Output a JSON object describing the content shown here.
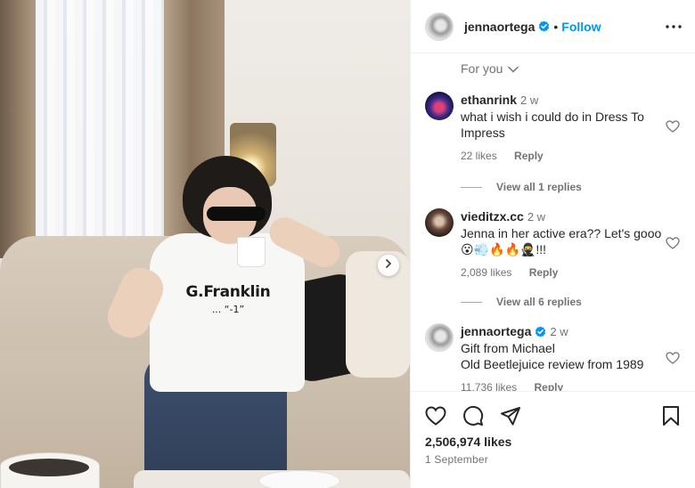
{
  "post": {
    "image_text": {
      "shirt_main": "G.Franklin",
      "shirt_sub": "... “-1”"
    }
  },
  "header": {
    "username": "jennaortega",
    "dot": "•",
    "follow_label": "Follow"
  },
  "comments_header": {
    "sort_label": "For you"
  },
  "comments": [
    {
      "username": "ethanrink",
      "time": "2 w",
      "text": "what i wish i could do in Dress To Impress",
      "likes": "22 likes",
      "reply_label": "Reply",
      "view_replies": "View all 1 replies"
    },
    {
      "username": "vieditzx.cc",
      "time": "2 w",
      "text": "Jenna in her active era?? Let's gooo",
      "emoji_line": "😮💨🔥🔥🥷!!!",
      "likes": "2,089 likes",
      "reply_label": "Reply",
      "view_replies": "View all 6 replies"
    },
    {
      "username": "jennaortega",
      "time": "2 w",
      "text": "Gift from Michael",
      "text2": "Old Beetlejuice review from 1989",
      "likes": "11,736 likes",
      "reply_label": "Reply"
    }
  ],
  "footer": {
    "likes_count": "2,506,974 likes",
    "date": "1 September"
  },
  "colors": {
    "accent": "#0095f6",
    "verified": "#0095f6",
    "secondary_text": "#737373",
    "primary_text": "#262626",
    "border": "#efefef"
  },
  "icons": [
    "next-arrow-icon",
    "verified-badge-icon",
    "more-options-icon",
    "chevron-down-icon",
    "heart-icon",
    "comment-icon",
    "share-icon",
    "bookmark-icon"
  ]
}
